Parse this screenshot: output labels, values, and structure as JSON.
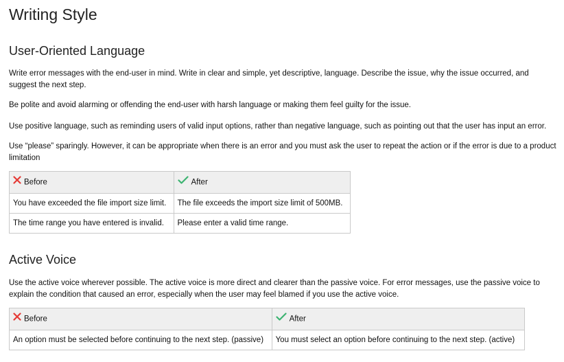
{
  "title": "Writing Style",
  "sections": {
    "user_oriented": {
      "heading": "User-Oriented Language",
      "paragraphs": [
        "Write error messages with the end-user in mind.  Write in clear and simple, yet descriptive, language. Describe the issue, why the issue occurred, and suggest the next step.",
        "Be polite and avoid alarming or offending the end-user with harsh language or making them feel guilty for the issue.",
        "Use positive language, such as reminding users of valid input options, rather than negative language, such as pointing out that the user has input an error.",
        "Use “please” sparingly. However, it can be appropriate when there is an error and you must ask the user to repeat the action or if the error is due to a product limitation"
      ],
      "table": {
        "headers": {
          "before": "Before",
          "after": "After"
        },
        "rows": [
          {
            "before": "You have exceeded the file import size limit.",
            "after": "The file exceeds the import size limit of 500MB."
          },
          {
            "before": "The time range you have entered is invalid.",
            "after": "Please enter a valid time range."
          }
        ]
      }
    },
    "active_voice": {
      "heading": "Active Voice",
      "paragraphs": [
        "Use the active voice wherever possible. The active voice is more direct and clearer than the passive voice. For error messages, use the passive voice to explain the condition that caused an error, especially when the user may feel blamed if you use the active voice."
      ],
      "table": {
        "headers": {
          "before": "Before",
          "after": "After"
        },
        "rows": [
          {
            "before": "An option must be selected before continuing to the next step. (passive)",
            "after": "You must select an option before continuing to the next step. (active)"
          }
        ]
      }
    }
  },
  "icons": {
    "before": "red-x-icon",
    "after": "green-check-icon"
  },
  "colors": {
    "cross": "#e53935",
    "check": "#3cb371",
    "table_header_bg": "#efefef",
    "table_border": "#c9c9c9"
  }
}
